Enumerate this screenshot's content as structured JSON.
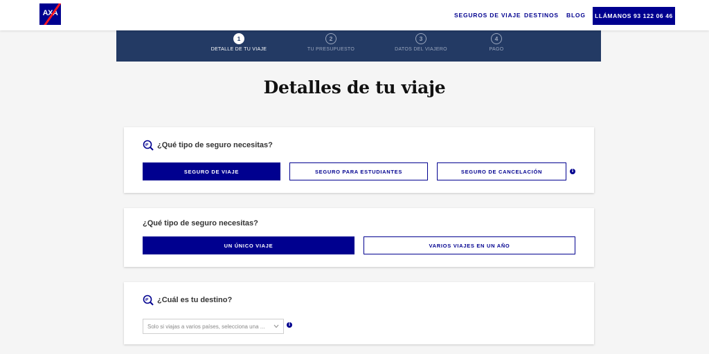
{
  "header": {
    "logo_text": "AXA",
    "nav": [
      "SEGUROS DE VIAJE",
      "DESTINOS",
      "BLOG"
    ],
    "call_label": "LLÁMANOS 93 122 06 46"
  },
  "stepper": {
    "steps": [
      {
        "num": "1",
        "label": "DETALLE DE TU VIAJE"
      },
      {
        "num": "2",
        "label": "TU PRESUPUESTO"
      },
      {
        "num": "3",
        "label": "DATOS DEL VIAJERO"
      },
      {
        "num": "4",
        "label": "PAGO"
      }
    ]
  },
  "page_title": "Detalles de tu viaje",
  "card1": {
    "question": "¿Qué tipo de seguro necesitas?",
    "options": [
      "SEGURO DE VIAJE",
      "SEGURO PARA ESTUDIANTES",
      "SEGURO DE CANCELACIÓN"
    ],
    "info": "i"
  },
  "card2": {
    "question": "¿Qué tipo de seguro necesitas?",
    "options": [
      "UN ÚNICO VIAJE",
      "VARIOS VIAJES EN UN AÑO"
    ]
  },
  "card3": {
    "question": "¿Cuál es tu destino?",
    "select_placeholder": "Solo si viajas a varios países, selecciona una ...",
    "info": "i"
  },
  "colors": {
    "brand": "#00008f",
    "stepper_bg": "#233a64",
    "accent_red": "#ff1721"
  }
}
